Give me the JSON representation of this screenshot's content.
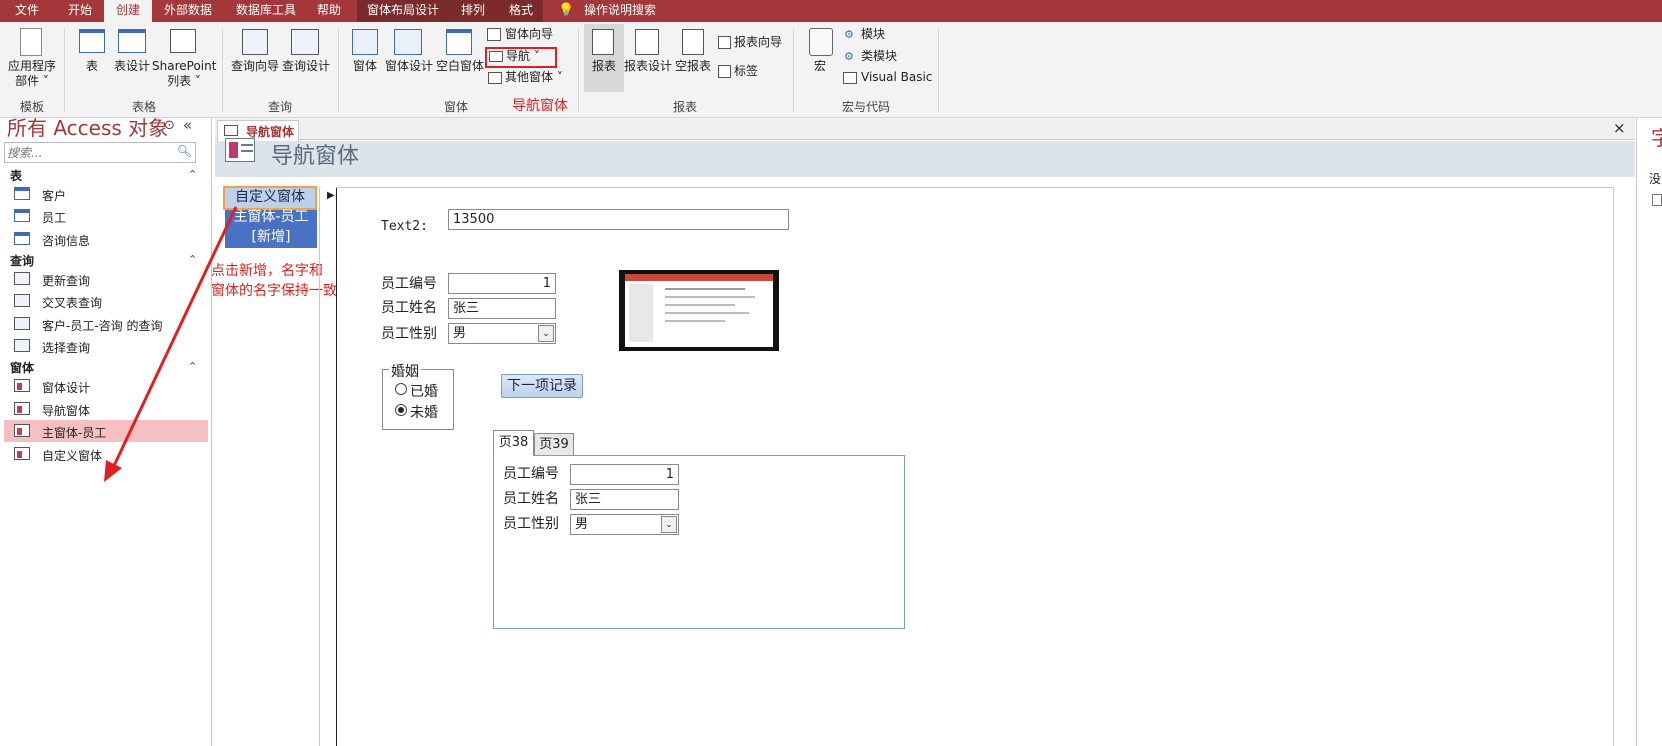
{
  "menu": {
    "tabs": [
      "文件",
      "开始",
      "创建",
      "外部数据",
      "数据库工具",
      "帮助"
    ],
    "selected": "创建",
    "context_tabs": [
      "窗体布局设计",
      "排列",
      "格式"
    ],
    "search_label": "操作说明搜索",
    "search_icon": "lightbulb-icon"
  },
  "ribbon": {
    "templates": {
      "app_parts": "应用程序\n部件 ˅",
      "group": "模板"
    },
    "tables": {
      "table": "表",
      "table_design": "表设计",
      "sharepoint": "SharePoint\n列表 ˅",
      "group": "表格"
    },
    "queries": {
      "wizard": "查询向导",
      "design": "查询设计",
      "group": "查询"
    },
    "forms": {
      "form": "窗体",
      "form_design": "窗体设计",
      "blank_form": "空白窗体",
      "form_wizard": "窗体向导",
      "navigation": "导航 ˅",
      "more_forms": "其他窗体 ˅",
      "group": "窗体"
    },
    "reports": {
      "report": "报表",
      "report_design": "报表设计",
      "blank_report": "空报表",
      "report_wizard": "报表向导",
      "labels": "标签",
      "group": "报表"
    },
    "macros": {
      "macro": "宏",
      "module": "模块",
      "class_module": "类模块",
      "vba": "Visual Basic",
      "group": "宏与代码"
    },
    "annotation": "导航窗体"
  },
  "nav_pane": {
    "title": "所有 Access 对象",
    "search_placeholder": "搜索...",
    "sections": [
      {
        "name": "表",
        "items": [
          "客户",
          "员工",
          "咨询信息"
        ]
      },
      {
        "name": "查询",
        "items": [
          "更新查询",
          "交叉表查询",
          "客户-员工-咨询 的查询",
          "选择查询"
        ]
      },
      {
        "name": "窗体",
        "items": [
          "窗体设计",
          "导航窗体",
          "主窗体-员工",
          "自定义窗体"
        ]
      }
    ],
    "selected_item": "主窗体-员工"
  },
  "document": {
    "tab_label": "导航窗体",
    "close": "×",
    "header_title": "导航窗体",
    "nav_buttons": [
      "自定义窗体",
      "主窗体-员工",
      "[新增]"
    ],
    "annotation": "点击新增，名字和\n窗体的名字保持一致",
    "text2_label": "Text2:",
    "text2_value": "13500",
    "fields": {
      "emp_id_label": "员工编号",
      "emp_id": "1",
      "emp_name_label": "员工姓名",
      "emp_name": "张三",
      "emp_gender_label": "员工性别",
      "emp_gender": "男"
    },
    "marriage": {
      "legend": "婚姻",
      "options": [
        "已婚",
        "未婚"
      ],
      "selected": "未婚"
    },
    "next_button": "下一项记录",
    "tabs": [
      "页38",
      "页39"
    ],
    "selected_tab": "页38",
    "tab_fields": {
      "emp_id_label": "员工编号",
      "emp_id": "1",
      "emp_name_label": "员工姓名",
      "emp_name": "张三",
      "emp_gender_label": "员工性别",
      "emp_gender": "男"
    }
  },
  "right_pane": {
    "title": "字",
    "text": "没"
  },
  "colors": {
    "accent": "#a4373a",
    "nav_button": "#4a72c4",
    "highlight": "#f6c0c2",
    "annotation": "#e02020",
    "orange": "#f3a23b"
  }
}
